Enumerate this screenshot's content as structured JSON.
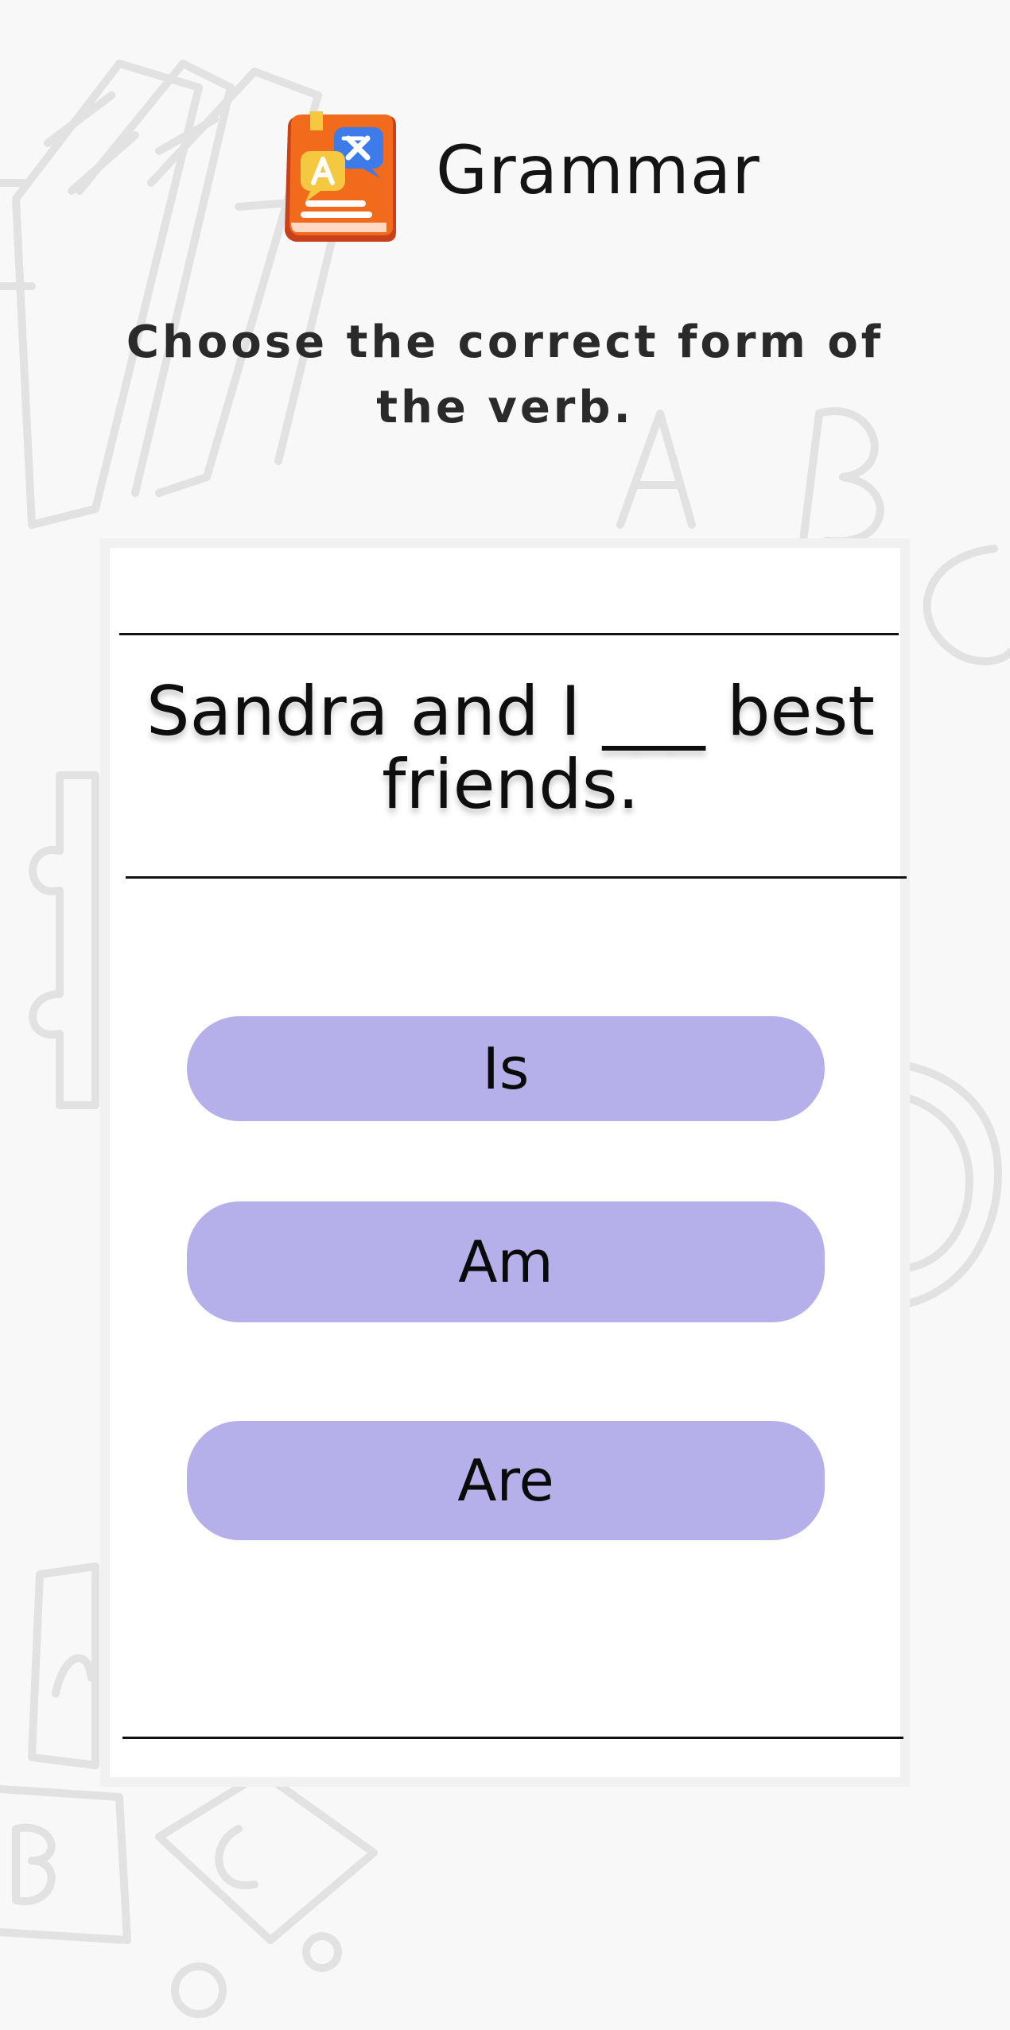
{
  "header": {
    "title": "Grammar",
    "icon": "grammar-book-icon"
  },
  "instruction": "Choose the correct form of the verb.",
  "question": {
    "text": "Sandra and I ___ best friends."
  },
  "answers": [
    {
      "label": "Is"
    },
    {
      "label": "Am"
    },
    {
      "label": "Are"
    }
  ],
  "colors": {
    "background": "#f8f8f8",
    "answer_button": "#b5b0ea",
    "logo_orange": "#f26a1b",
    "logo_blue": "#3e7bea",
    "logo_yellow": "#f5c842"
  }
}
